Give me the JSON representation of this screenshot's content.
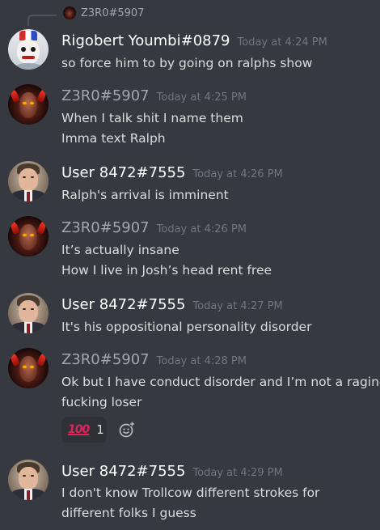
{
  "reply": {
    "author": "Z3R0#5907",
    "preview": ""
  },
  "messages": [
    {
      "author": "Rigobert Youmbi#0879",
      "timestamp": "Today at 4:24 PM",
      "lines": [
        "so force him to by going on ralphs show"
      ]
    },
    {
      "author": "Z3R0#5907",
      "timestamp": "Today at 4:25 PM",
      "lines": [
        "When I talk shit I name them",
        "Imma text Ralph"
      ]
    },
    {
      "author": "User 8472#7555",
      "timestamp": "Today at 4:26 PM",
      "lines": [
        "Ralph's arrival is imminent"
      ]
    },
    {
      "author": "Z3R0#5907",
      "timestamp": "Today at 4:26 PM",
      "lines": [
        "It’s actually insane",
        "How I live in Josh’s head rent free"
      ]
    },
    {
      "author": "User 8472#7555",
      "timestamp": "Today at 4:27 PM",
      "lines": [
        "It's his oppositional personality disorder"
      ]
    },
    {
      "author": "Z3R0#5907",
      "timestamp": "Today at 4:28 PM",
      "lines": [
        "Ok but I have conduct disorder and I’m not a raging",
        "fucking loser"
      ],
      "reaction": {
        "emoji": "100",
        "count": "1"
      }
    },
    {
      "author": "User 8472#7555",
      "timestamp": "Today at 4:29 PM",
      "lines": [
        "I don't know Trollcow different strokes for",
        "different folks I guess"
      ]
    }
  ],
  "icons": {
    "reply_spine": "reply-spine-icon",
    "add_reaction": "add-reaction-icon",
    "hundred_emoji": "hundred-points-icon"
  },
  "colors": {
    "background": "#36393f",
    "username_default": "#ffffff",
    "username_zero": "#a0a7ad",
    "timestamp": "#72767d",
    "text": "#dcddde",
    "reaction_bg": "#2f3136",
    "hundred": "#e0245e"
  }
}
